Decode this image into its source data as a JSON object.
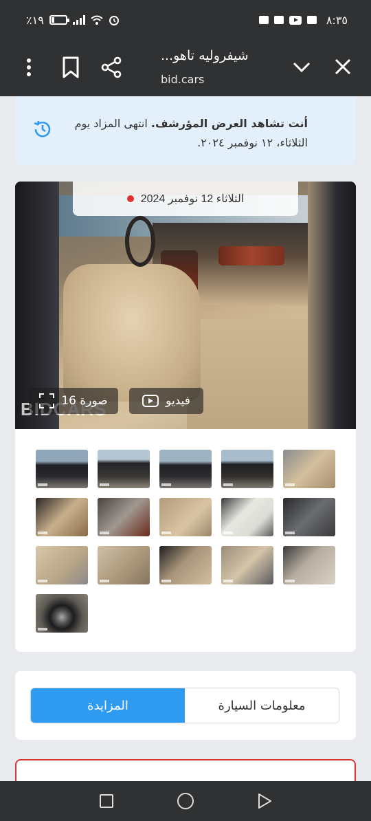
{
  "status_bar": {
    "time": "٨:٣٥",
    "battery": "٪١٩"
  },
  "browser": {
    "title": "شيفروليه تاهو...",
    "url": "bid.cars"
  },
  "notice": {
    "bold": "أنت تشاهد العرض المؤرشف.",
    "text": " انتهى المزاد يوم الثلاثاء، ١٢ نوفمبر ٢٠٢٤."
  },
  "gallery": {
    "date": "الثلاثاء 12 نوفمبر 2024",
    "watermark": "BIDCARS",
    "video_label": "فيديو",
    "photos_label": "صورة 16",
    "thumbnails": [
      {
        "subject": "exterior-front"
      },
      {
        "subject": "exterior-front-2"
      },
      {
        "subject": "exterior-rear"
      },
      {
        "subject": "exterior-rear-2"
      },
      {
        "subject": "interior-front"
      },
      {
        "subject": "door-panel"
      },
      {
        "subject": "dashboard-cluster"
      },
      {
        "subject": "rear-seats"
      },
      {
        "subject": "window-sticker"
      },
      {
        "subject": "engine"
      },
      {
        "subject": "seat-detail"
      },
      {
        "subject": "seat-controls"
      },
      {
        "subject": "seat-closeup"
      },
      {
        "subject": "steering-wheel"
      },
      {
        "subject": "scratched-panel"
      },
      {
        "subject": "wheel"
      }
    ]
  },
  "tabs": {
    "auction": "المزايدة",
    "car_info": "معلومات السيارة",
    "active": "auction"
  },
  "colors": {
    "accent": "#2e9bf0",
    "bar": "#303133",
    "notice_bg": "#e3effa",
    "alert": "#d93636"
  }
}
